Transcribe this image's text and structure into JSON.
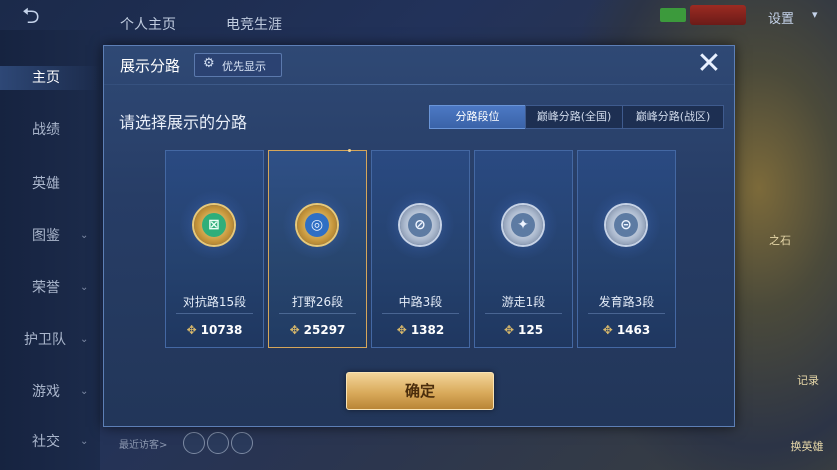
{
  "top_bar": {
    "tab_personal": "个人主页",
    "tab_career": "电竞生涯",
    "settings": "设置"
  },
  "left_nav": [
    {
      "label": "主页",
      "active": true,
      "chevron": false
    },
    {
      "label": "战绩",
      "active": false,
      "chevron": false
    },
    {
      "label": "英雄",
      "active": false,
      "chevron": false
    },
    {
      "label": "图鉴",
      "active": false,
      "chevron": true
    },
    {
      "label": "荣誉",
      "active": false,
      "chevron": true
    },
    {
      "label": "护卫队",
      "active": false,
      "chevron": true
    },
    {
      "label": "游戏",
      "active": false,
      "chevron": true
    },
    {
      "label": "社交",
      "active": false,
      "chevron": true
    }
  ],
  "bottom_bar": {
    "recent_visitors": "最近访客>"
  },
  "right_side": {
    "stone_label": "之石",
    "change_hero": "换英雄",
    "record": "记录"
  },
  "modal": {
    "title": "展示分路",
    "priority_button": "优先显示",
    "prompt": "请选择展示的分路",
    "segments": [
      {
        "label": "分路段位",
        "active": true
      },
      {
        "label": "巅峰分路(全国)",
        "active": false
      },
      {
        "label": "巅峰分路(战区)",
        "active": false
      }
    ],
    "lanes": [
      {
        "rank": "对抗路15段",
        "score": "10738",
        "emblem_style": "gold",
        "glyph": "⊠",
        "inner": "green",
        "selected": false
      },
      {
        "rank": "打野26段",
        "score": "25297",
        "emblem_style": "gold",
        "glyph": "◎",
        "inner": "blue",
        "selected": true
      },
      {
        "rank": "中路3段",
        "score": "1382",
        "emblem_style": "silver",
        "glyph": "⊘",
        "inner": "steel",
        "selected": false
      },
      {
        "rank": "游走1段",
        "score": "125",
        "emblem_style": "silver",
        "glyph": "✦",
        "inner": "steel",
        "selected": false
      },
      {
        "rank": "发育路3段",
        "score": "1463",
        "emblem_style": "silver",
        "glyph": "⊝",
        "inner": "steel",
        "selected": false
      }
    ],
    "confirm": "确定"
  },
  "colors": {
    "accent_gold": "#d9aa5b",
    "modal_bg": "#2f4975",
    "selected_border": "#d5a65a"
  }
}
